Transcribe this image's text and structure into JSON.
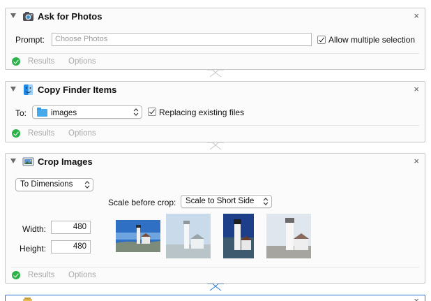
{
  "actions": [
    {
      "title": "Ask for Photos",
      "icon": "photos-icon",
      "prompt_label": "Prompt:",
      "prompt_placeholder": "Choose Photos",
      "allow_multiple_label": "Allow multiple selection",
      "allow_multiple_checked": true,
      "status": "ok",
      "tabs": [
        "Results",
        "Options"
      ]
    },
    {
      "title": "Copy Finder Items",
      "icon": "finder-icon",
      "to_label": "To:",
      "destination": "images",
      "replacing_label": "Replacing existing files",
      "replacing_checked": true,
      "status": "ok",
      "tabs": [
        "Results",
        "Options"
      ]
    },
    {
      "title": "Crop Images",
      "icon": "preview-icon",
      "mode": "To Dimensions",
      "scale_label": "Scale before crop:",
      "scale_value": "Scale to Short Side",
      "width_label": "Width:",
      "width_value": "480",
      "height_label": "Height:",
      "height_value": "480",
      "thumbnails": [
        "lighthouse-photo",
        "lighthouse-photo",
        "lighthouse-photo",
        "lighthouse-photo"
      ],
      "status": "ok",
      "tabs": [
        "Results",
        "Options"
      ]
    }
  ],
  "close_glyph": "×",
  "colors": {
    "ok_green": "#2db24a",
    "selection_blue": "#2a76cf",
    "folder_blue": "#47a8ec"
  }
}
